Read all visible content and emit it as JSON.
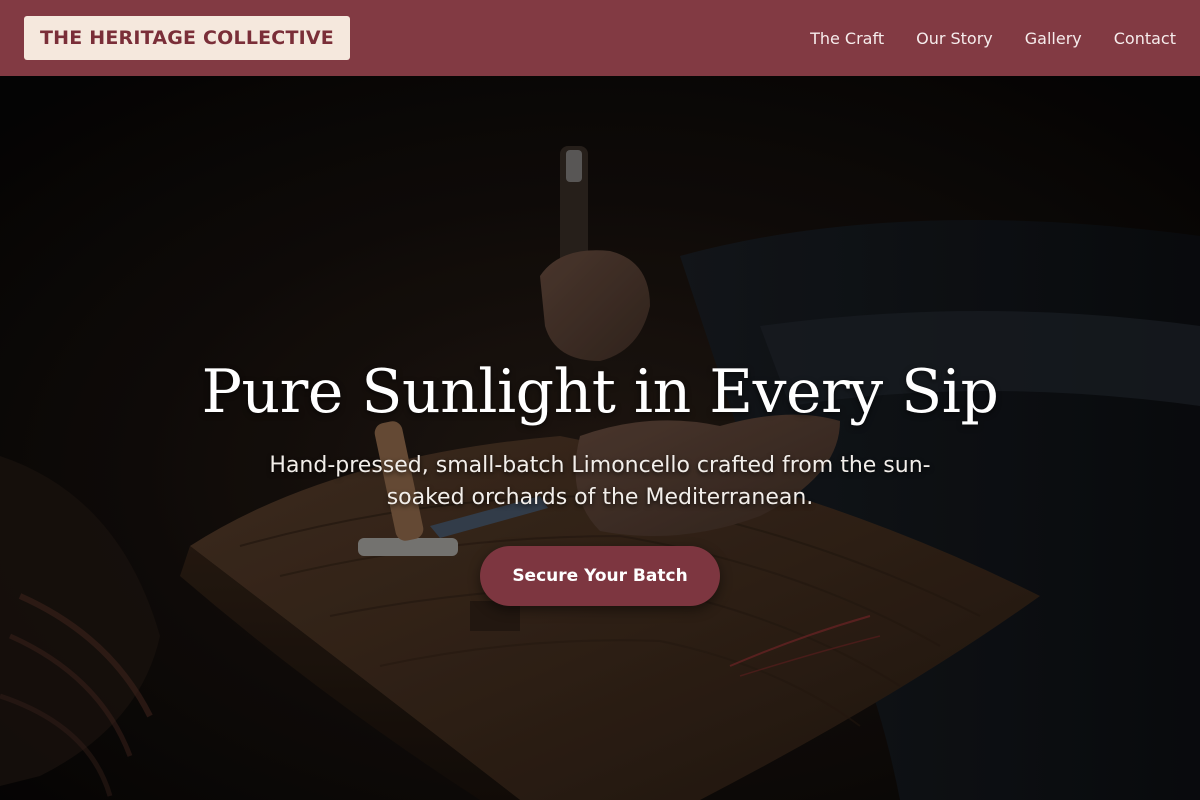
{
  "brand": {
    "name": "THE HERITAGE COLLECTIVE"
  },
  "nav": {
    "items": [
      {
        "label": "The Craft"
      },
      {
        "label": "Our Story"
      },
      {
        "label": "Gallery"
      },
      {
        "label": "Contact"
      }
    ]
  },
  "hero": {
    "title": "Pure Sunlight in Every Sip",
    "subtitle": "Hand-pressed, small-batch Limoncello crafted from the sun-soaked orchards of the Mediterranean.",
    "cta_label": "Secure Your Batch",
    "image_subject": "artisan-hands-hammer-wooden-workbench-photo"
  },
  "colors": {
    "header_bg": "#823a43",
    "logo_bg": "#f5e8dd",
    "logo_text": "#7a2e38",
    "cta_bg": "#7d3640",
    "nav_text": "#f6ecec"
  }
}
